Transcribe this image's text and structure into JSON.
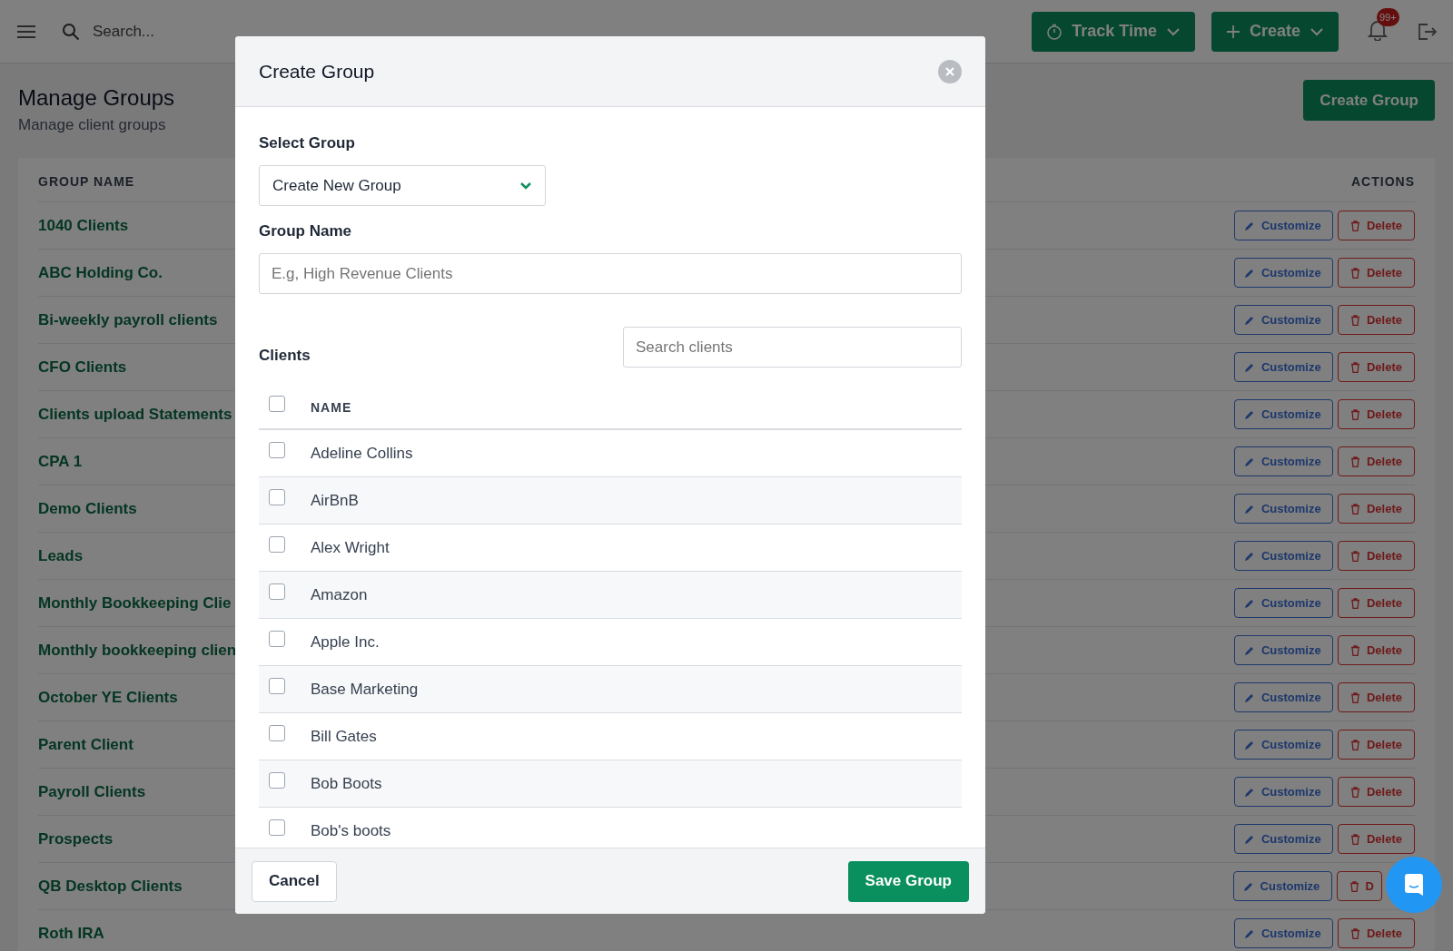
{
  "topbar": {
    "search": {
      "placeholder": "Search..."
    },
    "track_time_button": "Track Time",
    "create_button": "Create",
    "notification_badge": "99+"
  },
  "page": {
    "title": "Manage Groups",
    "subtitle": "Manage client groups",
    "create_group_button": "Create Group"
  },
  "groups_table": {
    "columns": [
      "GROUP NAME",
      "ACTIONS"
    ],
    "rows": [
      {
        "name": "1040 Clients",
        "customize": "Customize",
        "delete": "Delete"
      },
      {
        "name": "ABC Holding Co.",
        "customize": "Customize",
        "delete": "Delete"
      },
      {
        "name": "Bi-weekly payroll clients",
        "customize": "Customize",
        "delete": "Delete"
      },
      {
        "name": "CFO Clients",
        "customize": "Customize",
        "delete": "Delete"
      },
      {
        "name": "Clients upload Statements",
        "customize": "Customize",
        "delete": "Delete"
      },
      {
        "name": "CPA 1",
        "customize": "Customize",
        "delete": "Delete"
      },
      {
        "name": "Demo Clients",
        "customize": "Customize",
        "delete": "Delete"
      },
      {
        "name": "Leads",
        "customize": "Customize",
        "delete": "Delete"
      },
      {
        "name": "Monthly Bookkeeping Clie",
        "customize": "Customize",
        "delete": "Delete"
      },
      {
        "name": "Monthly bookkeeping clien",
        "customize": "Customize",
        "delete": "Delete"
      },
      {
        "name": "October YE Clients",
        "customize": "Customize",
        "delete": "Delete"
      },
      {
        "name": "Parent Client",
        "customize": "Customize",
        "delete": "Delete"
      },
      {
        "name": "Payroll Clients",
        "customize": "Customize",
        "delete": "Delete"
      },
      {
        "name": "Prospects",
        "customize": "Customize",
        "delete": "Delete"
      },
      {
        "name": "QB Desktop Clients",
        "customize": "Customize",
        "delete": "D"
      },
      {
        "name": "Roth IRA",
        "customize": "Customize",
        "delete": "Delete"
      }
    ]
  },
  "modal": {
    "title": "Create Group",
    "select_group": {
      "label": "Select Group",
      "value": "Create New Group"
    },
    "group_name": {
      "label": "Group Name",
      "placeholder": "E.g, High Revenue Clients"
    },
    "clients": {
      "label": "Clients",
      "search_placeholder": "Search clients",
      "column": "NAME",
      "select_all_checked": false,
      "rows": [
        {
          "name": "Adeline Collins",
          "checked": false
        },
        {
          "name": "AirBnB",
          "checked": false
        },
        {
          "name": "Alex Wright",
          "checked": false
        },
        {
          "name": "Amazon",
          "checked": false
        },
        {
          "name": "Apple Inc.",
          "checked": false
        },
        {
          "name": "Base Marketing",
          "checked": false
        },
        {
          "name": "Bill Gates",
          "checked": false
        },
        {
          "name": "Bob Boots",
          "checked": false
        },
        {
          "name": "Bob's boots",
          "checked": false
        }
      ]
    },
    "cancel_button": "Cancel",
    "save_button": "Save Group"
  }
}
